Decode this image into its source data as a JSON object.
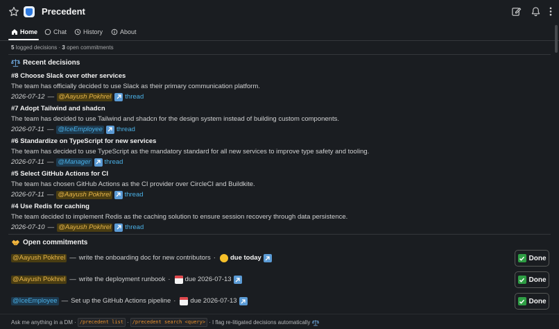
{
  "header": {
    "title": "Precedent",
    "icons": [
      "star-icon",
      "app-logo-icon",
      "edit-icon",
      "bell-icon",
      "more-icon"
    ]
  },
  "tabs": [
    {
      "label": "Home",
      "icon": "home-icon",
      "active": true
    },
    {
      "label": "Chat",
      "icon": "chat-icon",
      "active": false
    },
    {
      "label": "History",
      "icon": "history-icon",
      "active": false
    },
    {
      "label": "About",
      "icon": "info-icon",
      "active": false
    }
  ],
  "summary": {
    "decisions_count": "5",
    "decisions_label": " logged decisions · ",
    "commitments_count": "3",
    "commitments_label": " open commitments"
  },
  "decisions_section": {
    "title": "Recent decisions",
    "icon": "balance-scale-icon",
    "items": [
      {
        "title": "#8 Choose Slack over other services",
        "description": "The team has officially decided to use Slack as their primary communication platform.",
        "date": "2026-07-12",
        "dash": "—",
        "mention": "@Aayush Pokhrel",
        "thread": "thread"
      },
      {
        "title": "#7 Adopt Tailwind and shadcn",
        "description": "The team has decided to use Tailwind and shadcn for the design system instead of building custom components.",
        "date": "2026-07-11",
        "dash": "—",
        "mention": "@IceEmployee",
        "thread": "thread"
      },
      {
        "title": "#6 Standardize on TypeScript for new services",
        "description": "The team has decided to use TypeScript as the mandatory standard for all new services to improve type safety and tooling.",
        "date": "2026-07-11",
        "dash": "—",
        "mention": "@Manager",
        "thread": "thread"
      },
      {
        "title": "#5 Select GitHub Actions for CI",
        "description": "The team has chosen GitHub Actions as the CI provider over CircleCI and Buildkite.",
        "date": "2026-07-11",
        "dash": "—",
        "mention": "@Aayush Pokhrel",
        "thread": "thread"
      },
      {
        "title": "#4 Use Redis for caching",
        "description": "The team decided to implement Redis as the caching solution to ensure session recovery through data persistence.",
        "date": "2026-07-10",
        "dash": "—",
        "mention": "@Aayush Pokhrel",
        "thread": "thread"
      }
    ]
  },
  "commitments_section": {
    "title": "Open commitments",
    "icon": "handshake-icon",
    "done_label": "Done",
    "items": [
      {
        "mention": "@Aayush Pokhrel",
        "sep": "—",
        "task": "write the onboarding doc for new contributors",
        "dot": "·",
        "due": "due today",
        "due_icon": "yellow-circle-icon"
      },
      {
        "mention": "@Aayush Pokhrel",
        "sep": "—",
        "task": "write the deployment runbook",
        "dot": "·",
        "due": "due 2026-07-13",
        "due_icon": "calendar-icon"
      },
      {
        "mention": "@IceEmployee",
        "sep": "—",
        "task": "Set up the GitHub Actions pipeline",
        "dot": "·",
        "due": "due 2026-07-13",
        "due_icon": "calendar-icon"
      }
    ]
  },
  "footer": {
    "prefix": "Ask me anything in a DM ·",
    "cmd1": "/precedent list",
    "mid": "·",
    "cmd2": "/precedent search <query>",
    "suffix": "· I flag re-litigated decisions automatically"
  },
  "colors": {
    "background": "#1a1d21",
    "mention_yellow": "#e8b64a",
    "mention_blue": "#4ab0e6",
    "link": "#4ab0e6",
    "done_check": "#2e9e44"
  }
}
